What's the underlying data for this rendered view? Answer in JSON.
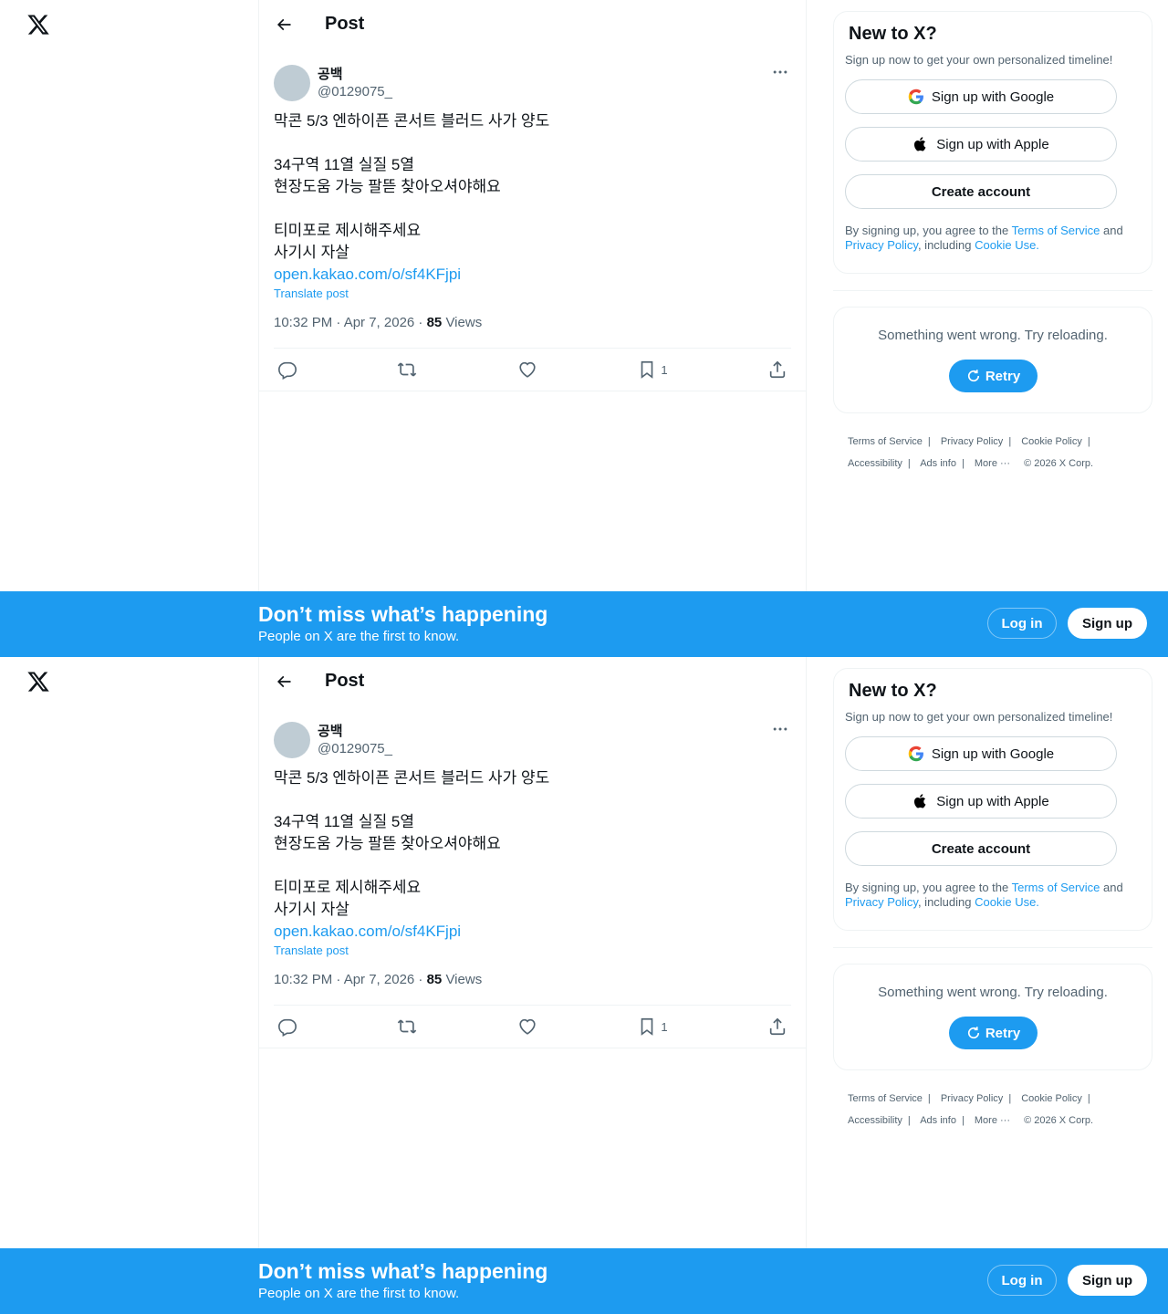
{
  "header": {
    "title": "Post"
  },
  "post": {
    "display_name": "공백",
    "handle": "@0129075_",
    "text": "막콘 5/3 엔하이픈 콘서트 블러드 사가 양도\n\n34구역 11열 실질 5열\n현장도움 가능 팔뜯 찾아오셔야해요\n\n티미포로 제시해주세요\n사기시 자살\n",
    "link": "open.kakao.com/o/sf4KFjpi",
    "translate": "Translate post",
    "time": "10:32 PM · Apr 7, 2026 · ",
    "views_count": "85",
    "views_label": " Views",
    "bookmark_count": "1"
  },
  "signup": {
    "title": "New to X?",
    "subtitle": "Sign up now to get your own personalized timeline!",
    "google": "Sign up with Google",
    "apple": "Sign up with Apple",
    "create": "Create account",
    "terms_pre": "By signing up, you agree to the ",
    "terms_link": "Terms of Service",
    "terms_and": " and ",
    "privacy_link": "Privacy Policy",
    "including": ", including ",
    "cookie_link": "Cookie Use."
  },
  "error": {
    "message": "Something went wrong. Try reloading.",
    "retry": "Retry"
  },
  "footer": {
    "terms": "Terms of Service",
    "privacy": "Privacy Policy",
    "cookie": "Cookie Policy",
    "accessibility": "Accessibility",
    "ads": "Ads info",
    "more": "More ···",
    "copyright": "© 2026 X Corp.",
    "separator": "|"
  },
  "banner": {
    "title": "Don’t miss what’s happening",
    "subtitle": "People on X are the first to know.",
    "login": "Log in",
    "signup": "Sign up"
  },
  "colors": {
    "accent": "#1d9bf0",
    "text": "#0f1419",
    "muted": "#536471",
    "avatar": "#bfccd4"
  }
}
